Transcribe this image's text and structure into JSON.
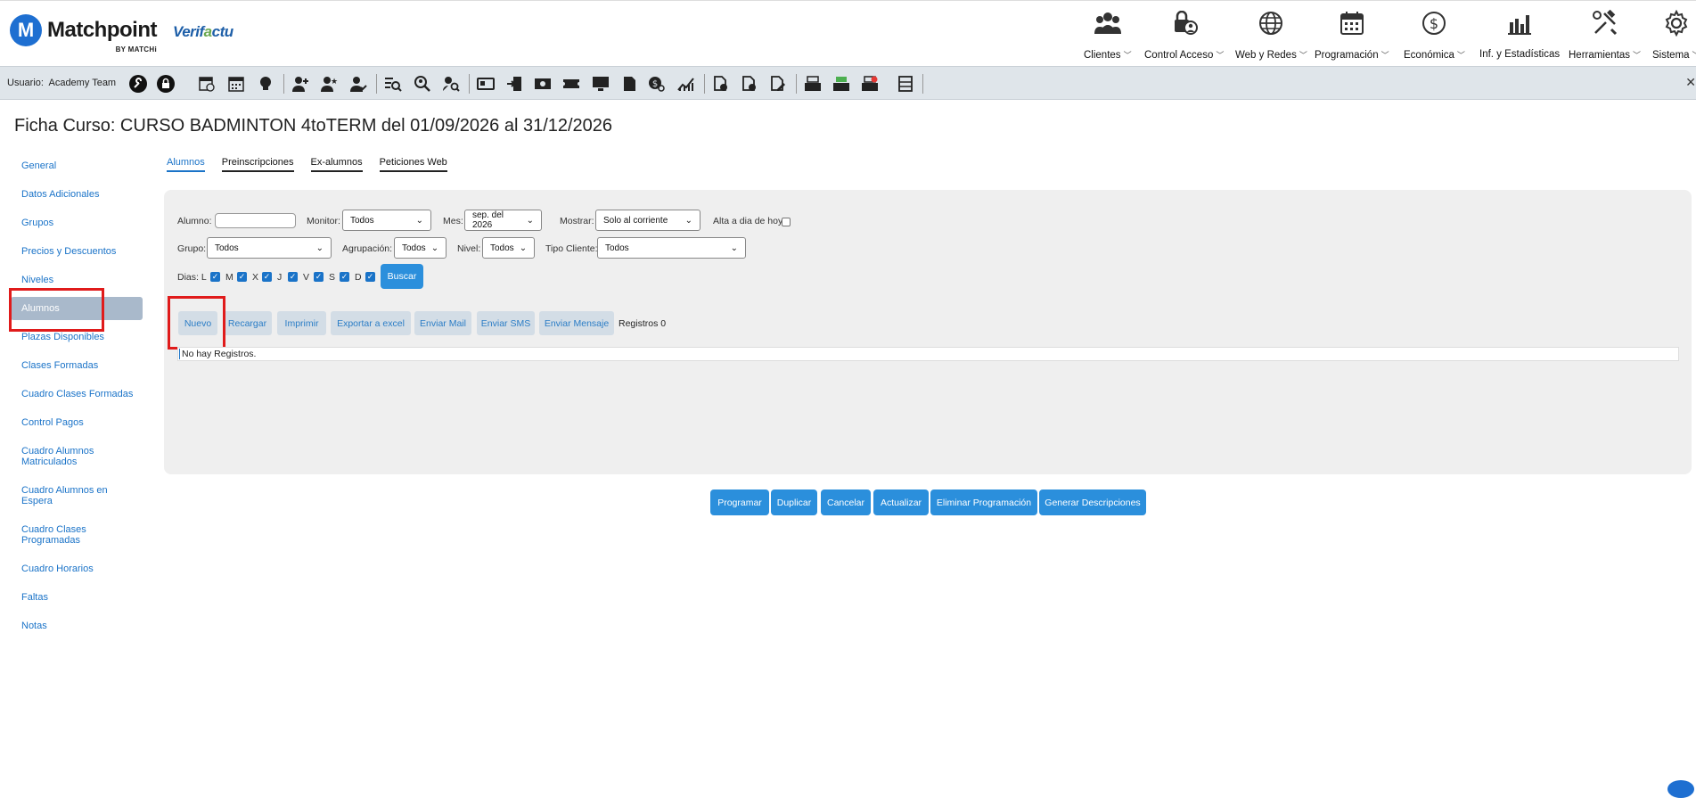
{
  "header": {
    "logo_letter": "M",
    "logo_name": "Matchpoint",
    "logo_sub": "BY MATCHi",
    "verifactu": "Verifactu",
    "nav": [
      {
        "label": "Clientes",
        "icon": "people-icon",
        "chevron": true
      },
      {
        "label": "Control Acceso",
        "icon": "lock-user-icon",
        "chevron": true
      },
      {
        "label": "Web y Redes",
        "icon": "globe-icon",
        "chevron": true
      },
      {
        "label": "Programación",
        "icon": "calendar-icon",
        "chevron": true
      },
      {
        "label": "Económica",
        "icon": "dollar-icon",
        "chevron": true
      },
      {
        "label": "Inf. y Estadísticas",
        "icon": "bar-chart-icon",
        "chevron": false
      },
      {
        "label": "Herramientas",
        "icon": "tools-icon",
        "chevron": true
      },
      {
        "label": "Sistema",
        "icon": "gear-icon",
        "chevron": true
      }
    ]
  },
  "toolbar": {
    "user_prefix": "Usuario:",
    "user_name": "Academy Team",
    "close_glyph": "✕"
  },
  "page": {
    "title": "Ficha Curso: CURSO BADMINTON 4toTERM del 01/09/2026 al 31/12/2026"
  },
  "sidebar": {
    "items": [
      {
        "label": "General"
      },
      {
        "label": "Datos Adicionales"
      },
      {
        "label": "Grupos"
      },
      {
        "label": "Precios y Descuentos"
      },
      {
        "label": "Niveles"
      },
      {
        "label": "Alumnos",
        "active": true
      },
      {
        "label": "Plazas Disponibles"
      },
      {
        "label": "Clases Formadas"
      },
      {
        "label": "Cuadro Clases Formadas"
      },
      {
        "label": "Control Pagos"
      },
      {
        "label": "Cuadro Alumnos Matriculados"
      },
      {
        "label": "Cuadro Alumnos en Espera"
      },
      {
        "label": "Cuadro Clases Programadas"
      },
      {
        "label": "Cuadro Horarios"
      },
      {
        "label": "Faltas"
      },
      {
        "label": "Notas"
      }
    ]
  },
  "tabs": [
    {
      "label": "Alumnos",
      "active": true
    },
    {
      "label": "Preinscripciones"
    },
    {
      "label": "Ex-alumnos"
    },
    {
      "label": "Peticiones Web"
    }
  ],
  "filters": {
    "alumno_label": "Alumno:",
    "alumno_value": "",
    "monitor_label": "Monitor:",
    "monitor_value": "Todos",
    "mes_label": "Mes:",
    "mes_value": "sep. del 2026",
    "mostrar_label": "Mostrar:",
    "mostrar_value": "Solo al corriente",
    "alta_label": "Alta a dia de hoy",
    "alta_checked": false,
    "grupo_label": "Grupo:",
    "grupo_value": "Todos",
    "agrupacion_label": "Agrupación:",
    "agrupacion_value": "Todos",
    "nivel_label": "Nivel:",
    "nivel_value": "Todos",
    "tipo_label": "Tipo Cliente:",
    "tipo_value": "Todos",
    "dias_label": "Dias: L",
    "dias": [
      "M",
      "X",
      "J",
      "V",
      "S",
      "D"
    ],
    "buscar": "Buscar"
  },
  "actions": {
    "nuevo": "Nuevo",
    "recargar": "Recargar",
    "imprimir": "Imprimir",
    "exportar": "Exportar a excel",
    "mail": "Enviar Mail",
    "sms": "Enviar SMS",
    "mensaje": "Enviar Mensaje",
    "registros": "Registros 0"
  },
  "results": {
    "empty_text": "No hay Registros."
  },
  "bottom_buttons": {
    "programar": "Programar",
    "duplicar": "Duplicar",
    "cancelar": "Cancelar",
    "actualizar": "Actualizar",
    "eliminar": "Eliminar Programación",
    "generar": "Generar Descripciones"
  },
  "colors": {
    "accent": "#2b8fdc",
    "highlight": "#e01b1b",
    "toolbar_bg": "#dfe5ea"
  }
}
